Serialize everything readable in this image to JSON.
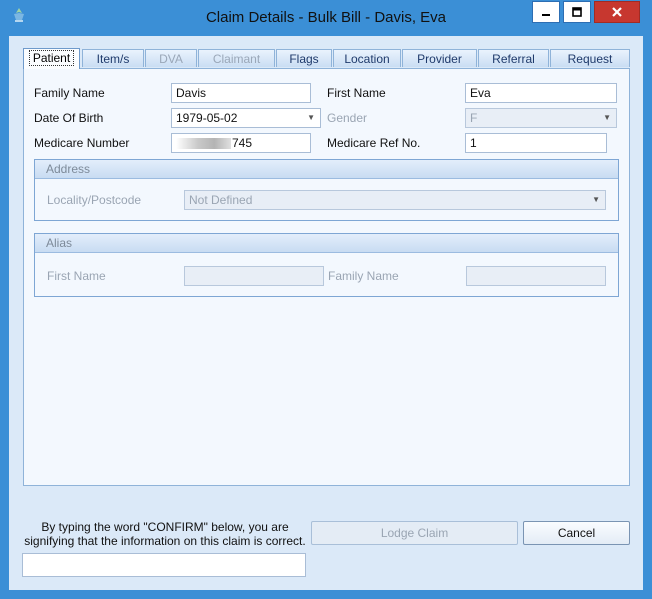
{
  "window": {
    "title": "Claim Details - Bulk Bill - Davis, Eva",
    "controls": {
      "minimize": "minimize",
      "maximize": "maximize",
      "close": "close"
    }
  },
  "tabs": [
    {
      "label": "Patient",
      "state": "active"
    },
    {
      "label": "Item/s",
      "state": "enabled"
    },
    {
      "label": "DVA",
      "state": "disabled"
    },
    {
      "label": "Claimant",
      "state": "disabled"
    },
    {
      "label": "Flags",
      "state": "enabled"
    },
    {
      "label": "Location",
      "state": "enabled"
    },
    {
      "label": "Provider",
      "state": "enabled"
    },
    {
      "label": "Referral",
      "state": "enabled"
    },
    {
      "label": "Request",
      "state": "enabled"
    }
  ],
  "patient": {
    "family_name_label": "Family Name",
    "family_name_value": "Davis",
    "first_name_label": "First Name",
    "first_name_value": "Eva",
    "dob_label": "Date Of Birth",
    "dob_value": "1979-05-02",
    "gender_label": "Gender",
    "gender_value": "F",
    "medicare_number_label": "Medicare Number",
    "medicare_number_visible_suffix": "745",
    "medicare_ref_label": "Medicare Ref No.",
    "medicare_ref_value": "1"
  },
  "address": {
    "header": "Address",
    "locality_label": "Locality/Postcode",
    "locality_value": "Not Defined"
  },
  "alias": {
    "header": "Alias",
    "first_name_label": "First Name",
    "first_name_value": "",
    "family_name_label": "Family Name",
    "family_name_value": ""
  },
  "footer": {
    "confirm_instruction": "By typing the word \"CONFIRM\" below, you are signifying that the information on this claim is correct.",
    "confirm_value": "",
    "lodge_label": "Lodge Claim",
    "cancel_label": "Cancel"
  },
  "colors": {
    "frame": "#3b8fd6",
    "client_bg": "#dbe9f8",
    "close_button": "#c7372f"
  }
}
